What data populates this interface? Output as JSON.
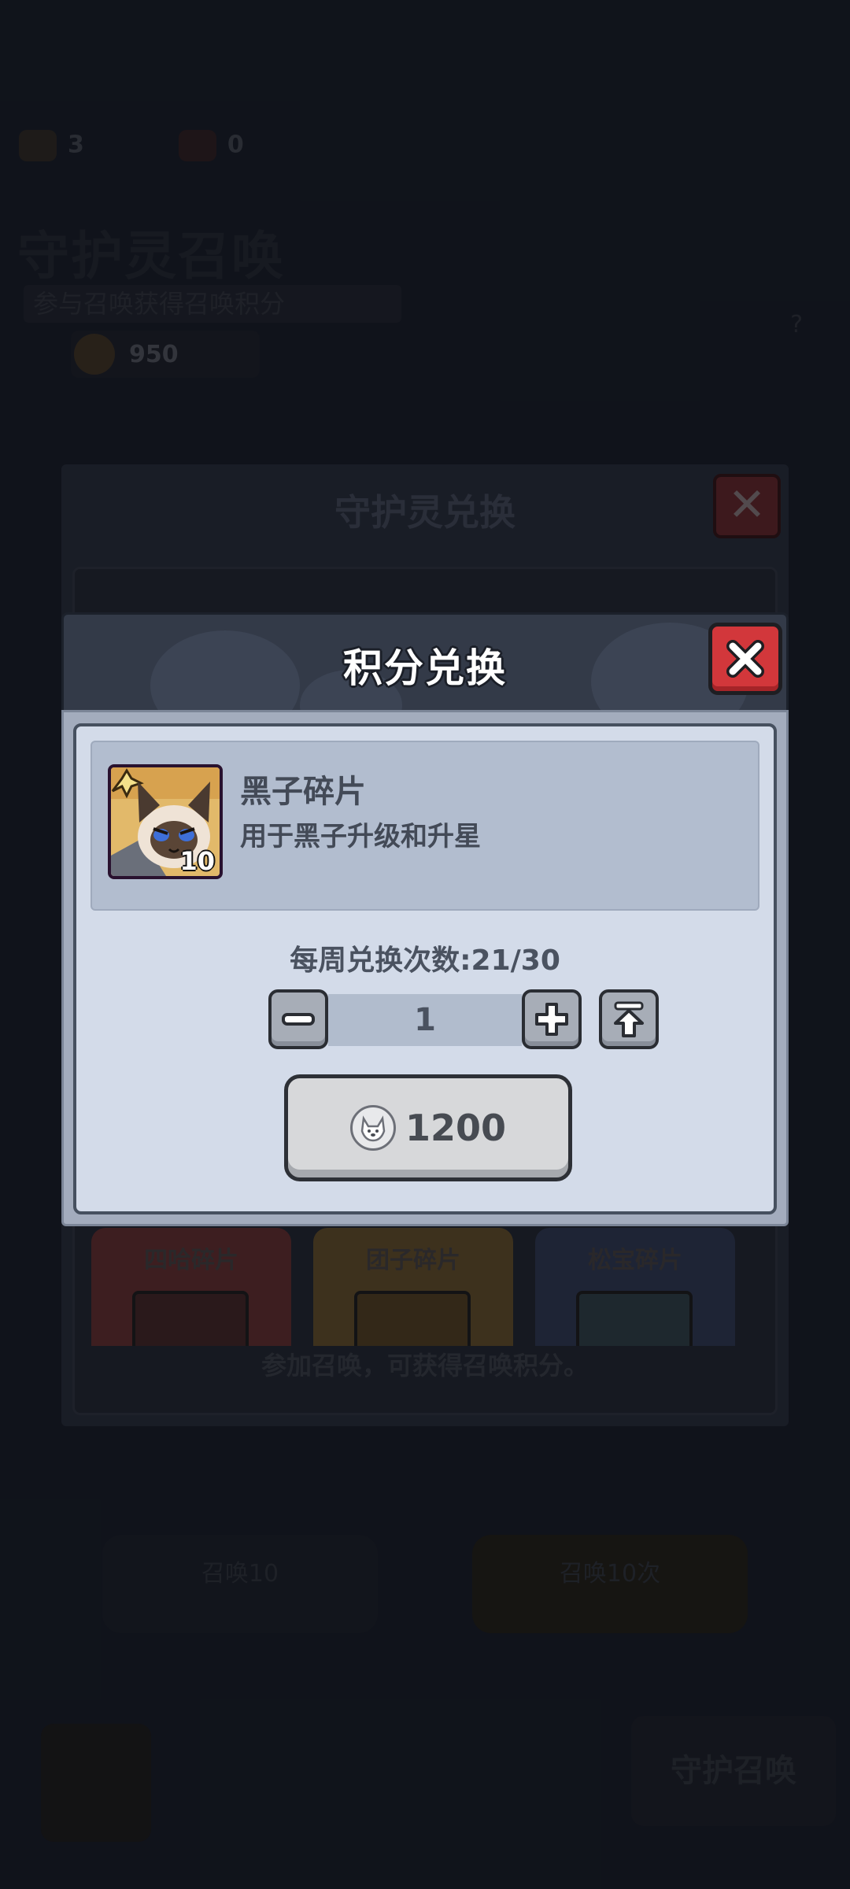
{
  "background": {
    "resources": [
      "3",
      "0"
    ],
    "title": "守护灵召唤",
    "subtitle": "参与召唤获得召唤积分",
    "score": "950",
    "exchange_modal": {
      "title": "守护灵兑换",
      "cards": [
        {
          "label": "四哈碎片",
          "color": "#5a2a2a",
          "img": "#3c2222"
        },
        {
          "label": "团子碎片",
          "color": "#5a4826",
          "img": "#4a3a1e"
        },
        {
          "label": "松宝碎片",
          "color": "#2a344a",
          "img": "#2a3a40"
        }
      ],
      "hint": "参加召唤，可获得召唤积分。"
    },
    "bottom_buttons": [
      "召唤10",
      "召唤10次"
    ],
    "summon_button": "守护召唤"
  },
  "dialog": {
    "title": "积分兑换",
    "item": {
      "name": "黑子碎片",
      "description": "用于黑子升级和升星",
      "count": "10"
    },
    "weekly_limit": "每周兑换次数:21/30",
    "quantity": "1",
    "price": "1200",
    "colors": {
      "close": "#d2373b",
      "item_frame": "#8e3fbe",
      "panel": "#d3dbe9"
    }
  }
}
